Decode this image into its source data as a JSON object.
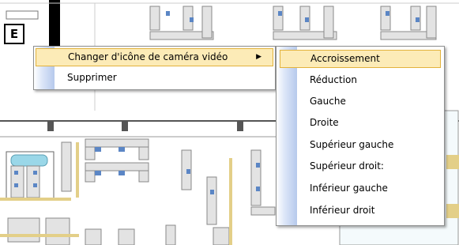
{
  "floorplan": {
    "room_label": "E"
  },
  "context_menu": {
    "items": [
      {
        "label": "Changer d'icône de caméra vidéo",
        "has_submenu": true,
        "active": true
      },
      {
        "label": "Supprimer",
        "has_submenu": false,
        "active": false
      }
    ]
  },
  "submenu": {
    "items": [
      {
        "label": "Accroissement",
        "active": true
      },
      {
        "label": "Réduction",
        "active": false
      },
      {
        "label": "Gauche",
        "active": false
      },
      {
        "label": "Droite",
        "active": false
      },
      {
        "label": "Supérieur gauche",
        "active": false
      },
      {
        "label": "Supérieur droit:",
        "active": false
      },
      {
        "label": "Inférieur gauche",
        "active": false
      },
      {
        "label": "Inférieur droit",
        "active": false
      }
    ]
  },
  "colors": {
    "highlight_bg": "#fcebb7",
    "highlight_border": "#e2b23c",
    "desk_fill": "#e3e3e3",
    "desk_accent": "#5b86c5",
    "partition_yellow": "#e3cf88"
  }
}
